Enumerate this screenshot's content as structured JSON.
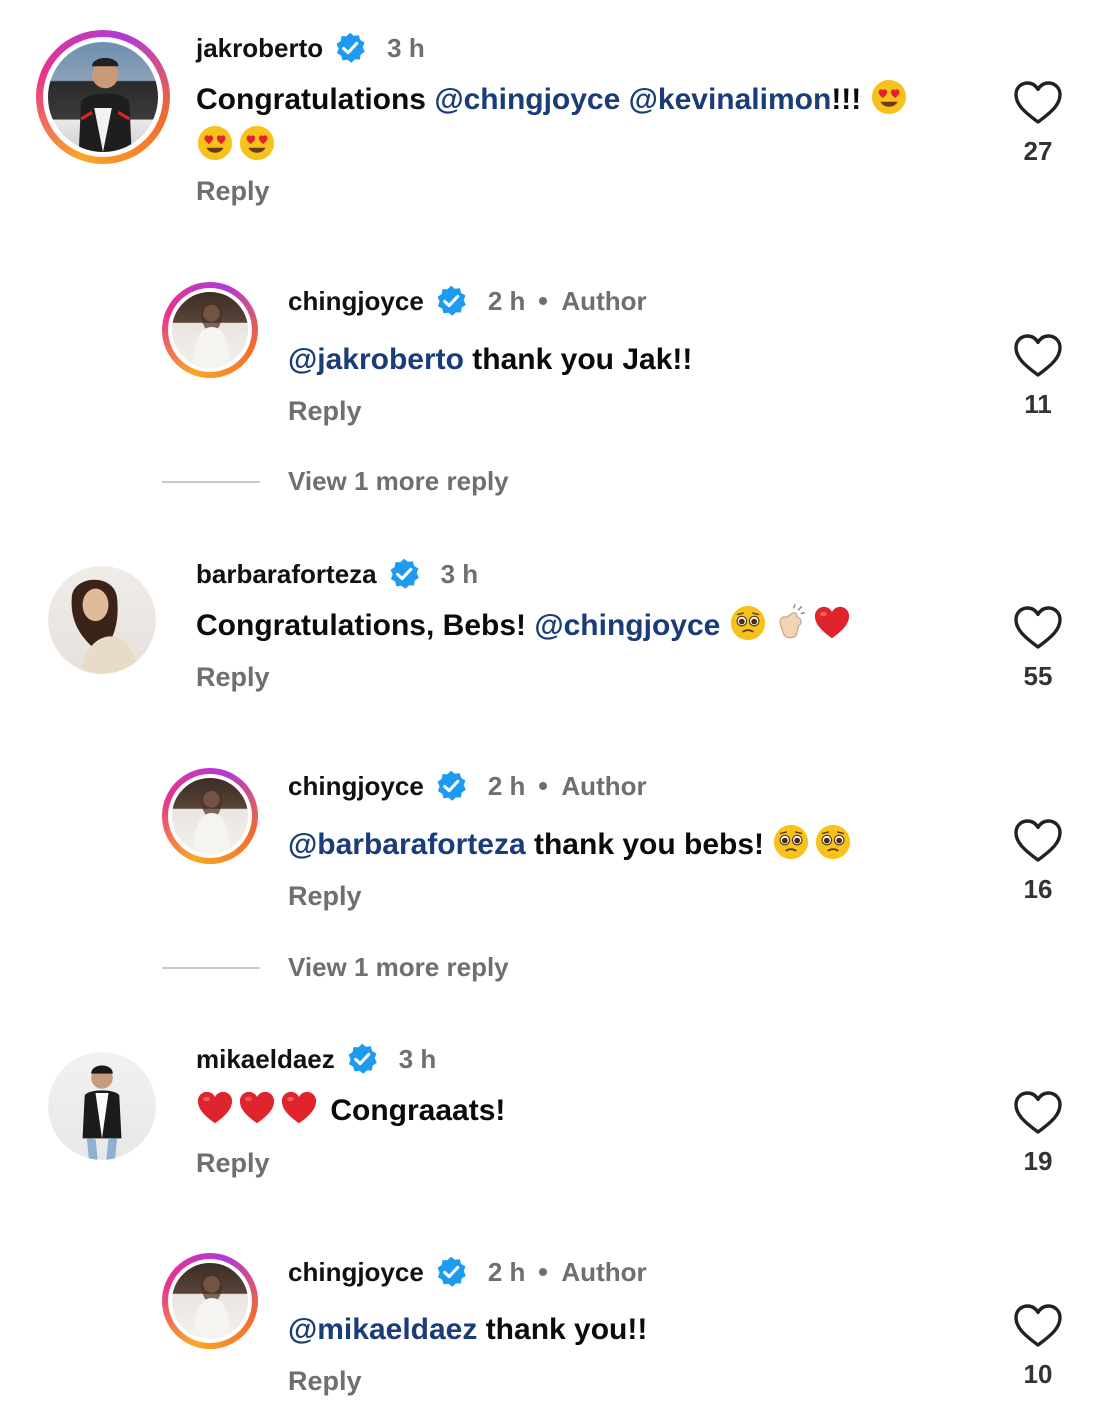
{
  "comments": [
    {
      "username": "jakroberto",
      "time": "3 h",
      "author_label": "",
      "text_parts": [
        {
          "t": "Congratulations "
        },
        {
          "m": "@chingjoyce"
        },
        {
          "t": " "
        },
        {
          "m": "@kevinalimon"
        },
        {
          "t": "!!! "
        }
      ],
      "emojis": [
        "heart-eyes-emoji",
        "heart-eyes-emoji",
        "heart-eyes-emoji"
      ],
      "reply_label": "Reply",
      "likes": "27"
    },
    {
      "username": "chingjoyce",
      "time": "2 h",
      "author_label": "Author",
      "text_parts": [
        {
          "m": "@jakroberto"
        },
        {
          "t": " thank you Jak!!"
        }
      ],
      "reply_label": "Reply",
      "likes": "11"
    },
    {
      "username": "barbaraforteza",
      "time": "3 h",
      "author_label": "",
      "text_parts": [
        {
          "t": "Congratulations, Bebs! "
        },
        {
          "m": "@chingjoyce"
        }
      ],
      "emojis": [
        "pleading-face-emoji",
        "clapping-hands-emoji",
        "red-heart-emoji"
      ],
      "reply_label": "Reply",
      "likes": "55"
    },
    {
      "username": "chingjoyce",
      "time": "2 h",
      "author_label": "Author",
      "text_parts": [
        {
          "m": "@barbaraforteza"
        },
        {
          "t": " thank you bebs! "
        }
      ],
      "emojis": [
        "pleading-face-emoji",
        "pleading-face-emoji"
      ],
      "reply_label": "Reply",
      "likes": "16"
    },
    {
      "username": "mikaeldaez",
      "time": "3 h",
      "author_label": "",
      "text_parts": [
        {
          "t": " Congraaats!"
        }
      ],
      "emojis_before": [
        "red-heart-emoji",
        "red-heart-emoji",
        "red-heart-emoji"
      ],
      "reply_label": "Reply",
      "likes": "19"
    },
    {
      "username": "chingjoyce",
      "time": "2 h",
      "author_label": "Author",
      "text_parts": [
        {
          "m": "@mikaeldaez"
        },
        {
          "t": " thank you!!"
        }
      ],
      "reply_label": "Reply",
      "likes": "10"
    }
  ],
  "view_more": [
    {
      "label": "View 1 more reply"
    },
    {
      "label": "View 1 more reply"
    }
  ],
  "colors": {
    "mention": "#1a3c78",
    "muted": "#6f6f6f",
    "verified": "#1d9bf0",
    "heart_emoji": "#e0242e"
  }
}
